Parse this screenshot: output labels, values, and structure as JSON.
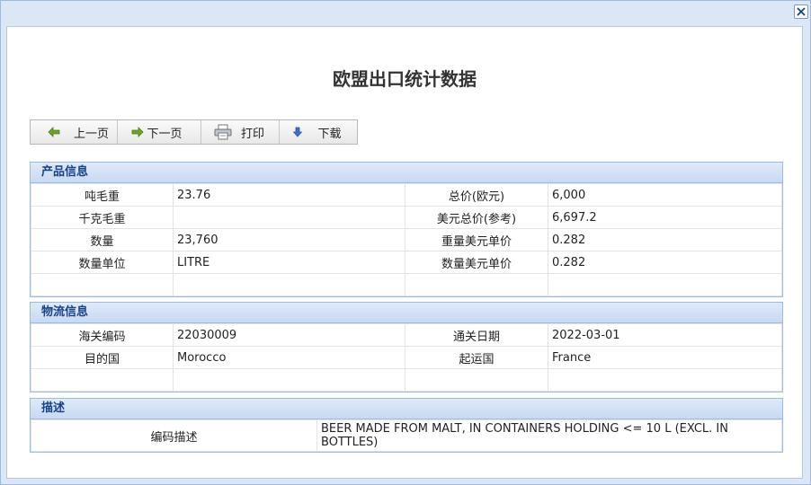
{
  "window": {
    "title": "欧盟出口统计数据"
  },
  "toolbar": {
    "prev_label": "上一页",
    "next_label": "下一页",
    "print_label": "打印",
    "download_label": "下载"
  },
  "product": {
    "heading": "产品信息",
    "rows": [
      [
        "吨毛重",
        "23.76",
        "总价(欧元)",
        "6,000"
      ],
      [
        "千克毛重",
        "",
        "美元总价(参考)",
        "6,697.2"
      ],
      [
        "数量",
        "23,760",
        "重量美元单价",
        "0.282"
      ],
      [
        "数量单位",
        "LITRE",
        "数量美元单价",
        "0.282"
      ],
      [
        "",
        "",
        "",
        ""
      ]
    ]
  },
  "logistics": {
    "heading": "物流信息",
    "rows": [
      [
        "海关编码",
        "22030009",
        "通关日期",
        "2022-03-01"
      ],
      [
        "目的国",
        "Morocco",
        "起运国",
        "France"
      ],
      [
        "",
        "",
        "",
        ""
      ]
    ]
  },
  "description": {
    "heading": "描述",
    "label": "编码描述",
    "value": "BEER MADE FROM MALT, IN CONTAINERS HOLDING <= 10 L (EXCL. IN BOTTLES)"
  },
  "colors": {
    "panel_header_text": "#15428b",
    "panel_border": "#99bbe8",
    "window_bg": "#dbe7f5",
    "prev_arrow": "#6aa52a",
    "next_arrow": "#6aa52a",
    "download_arrow": "#3a6fd0"
  },
  "icons": {
    "close": "close-icon",
    "prev": "left-arrow-icon",
    "next": "right-arrow-icon",
    "print": "printer-icon",
    "download": "down-arrow-icon"
  }
}
